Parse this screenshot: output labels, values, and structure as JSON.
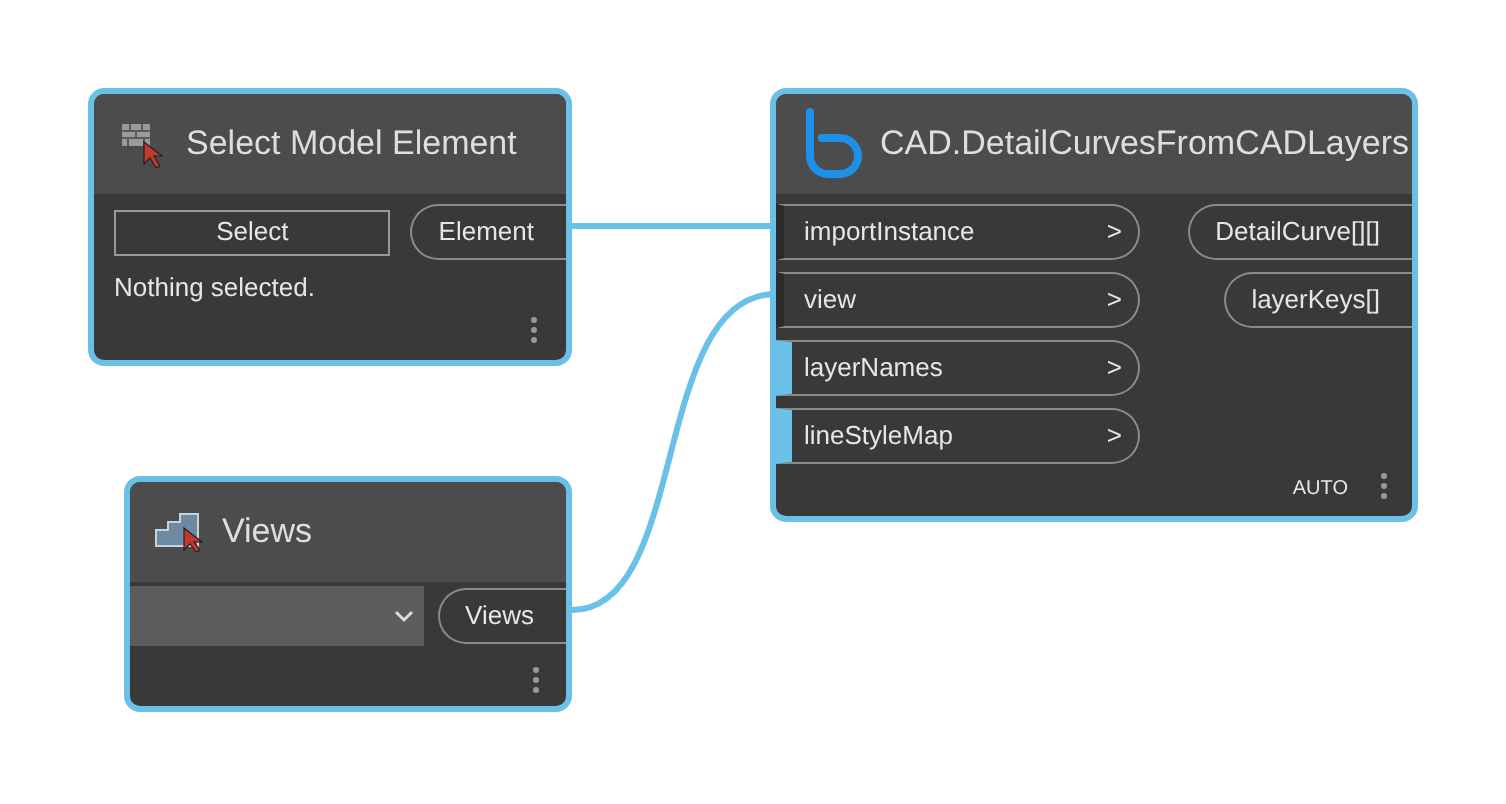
{
  "nodes": [
    {
      "kind": "selection",
      "title": "Select Model Element",
      "button": "Select",
      "status": "Nothing selected.",
      "outputs": [
        "Element"
      ]
    },
    {
      "kind": "function",
      "title": "CAD.DetailCurvesFromCADLayers",
      "inputs": [
        {
          "name": "importInstance",
          "arrow": ">",
          "connected": true
        },
        {
          "name": "view",
          "arrow": ">",
          "connected": true
        },
        {
          "name": "layerNames",
          "arrow": ">",
          "connected": false
        },
        {
          "name": "lineStyleMap",
          "arrow": ">",
          "connected": false
        }
      ],
      "outputs": [
        "DetailCurve[][]",
        "layerKeys[]"
      ],
      "lacing": "AUTO"
    },
    {
      "kind": "dropdown",
      "title": "Views",
      "outputs": [
        "Views"
      ]
    }
  ]
}
